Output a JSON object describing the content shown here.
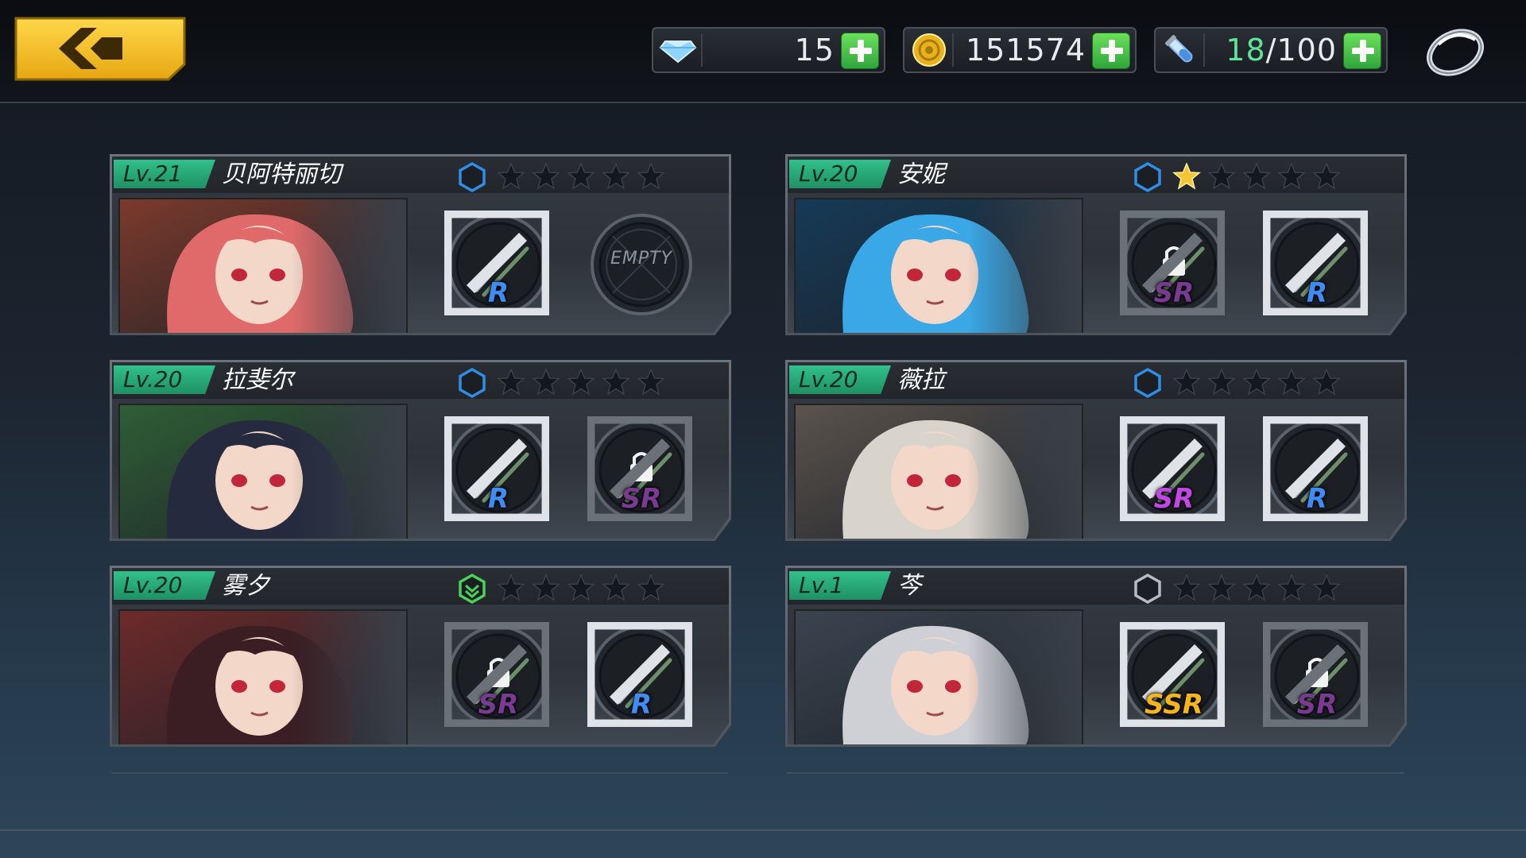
{
  "currencies": [
    {
      "icon": "diamond-icon",
      "value": "15"
    },
    {
      "icon": "gold-coin-icon",
      "value": "151574"
    },
    {
      "icon": "stamina-vial-icon",
      "current": "18",
      "separator": "/",
      "max": "100"
    }
  ],
  "characters": [
    {
      "level": "Lv.21",
      "name": "贝阿特丽切",
      "rank": "blue",
      "stars_filled": 0,
      "stars_total": 5,
      "portrait_hair": "#e06a6a",
      "portrait_bg": "#7b3a2c",
      "slots": [
        {
          "rarity": "R",
          "locked": false,
          "empty": false,
          "icon": "sword-icon"
        },
        {
          "rarity": "",
          "locked": false,
          "empty": true,
          "empty_label": "EMPTY",
          "icon": "empty-slot-icon"
        }
      ]
    },
    {
      "level": "Lv.20",
      "name": "安妮",
      "rank": "blue",
      "stars_filled": 1,
      "stars_total": 5,
      "portrait_hair": "#3aa8e6",
      "portrait_bg": "#163a57",
      "slots": [
        {
          "rarity": "SR",
          "locked": true,
          "empty": false,
          "icon": "cannon-icon"
        },
        {
          "rarity": "R",
          "locked": false,
          "empty": false,
          "icon": "wand-icon"
        }
      ]
    },
    {
      "level": "Lv.20",
      "name": "拉斐尔",
      "rank": "blue",
      "stars_filled": 0,
      "stars_total": 5,
      "portrait_hair": "#252a3e",
      "portrait_bg": "#2f5e36",
      "slots": [
        {
          "rarity": "R",
          "locked": false,
          "empty": false,
          "icon": "twin-blades-icon"
        },
        {
          "rarity": "SR",
          "locked": true,
          "empty": false,
          "icon": "chain-icon"
        }
      ]
    },
    {
      "level": "Lv.20",
      "name": "薇拉",
      "rank": "blue",
      "stars_filled": 0,
      "stars_total": 5,
      "portrait_hair": "#d8d4cc",
      "portrait_bg": "#5a534d",
      "slots": [
        {
          "rarity": "SR",
          "locked": false,
          "empty": false,
          "icon": "death-cannon-icon"
        },
        {
          "rarity": "R",
          "locked": false,
          "empty": false,
          "icon": "blaster-icon"
        }
      ]
    },
    {
      "level": "Lv.20",
      "name": "雾夕",
      "rank": "green",
      "stars_filled": 0,
      "stars_total": 5,
      "portrait_hair": "#3a1e24",
      "portrait_bg": "#6d2a2a",
      "slots": [
        {
          "rarity": "SR",
          "locked": true,
          "empty": false,
          "icon": "fan-icon"
        },
        {
          "rarity": "R",
          "locked": false,
          "empty": false,
          "icon": "staff-icon"
        }
      ]
    },
    {
      "level": "Lv.1",
      "name": "芩",
      "rank": "gray",
      "stars_filled": 0,
      "stars_total": 5,
      "portrait_hair": "#cfcfd6",
      "portrait_bg": "#3a4450",
      "slots": [
        {
          "rarity": "SSR",
          "locked": false,
          "empty": false,
          "icon": "twin-katana-icon"
        },
        {
          "rarity": "SR",
          "locked": true,
          "empty": false,
          "icon": "claw-icon"
        }
      ]
    }
  ],
  "colors": {
    "level_badge": "#31c18a",
    "rank_blue": "#2f8ee6",
    "rank_green": "#4ad15a",
    "rank_gray": "#b6bcc2",
    "star_filled": "#f5c534",
    "star_empty": "#14171b"
  }
}
